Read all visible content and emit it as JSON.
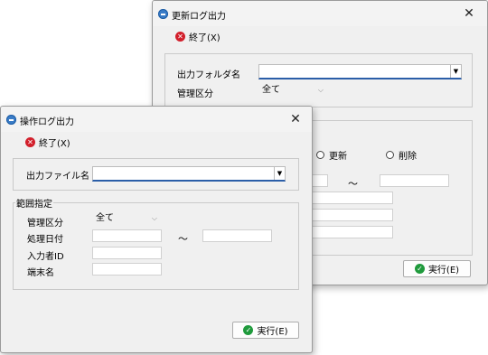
{
  "back_window": {
    "title": "更新ログ出力",
    "exit_label": "終了(X)",
    "folder_label": "出力フォルダ名",
    "folder_value": "",
    "category_label": "管理区分",
    "category_value": "全て",
    "radio_update": "更新",
    "radio_delete": "削除",
    "tilde": "～",
    "execute_label": "実行(E)"
  },
  "front_window": {
    "title": "操作ログ出力",
    "exit_label": "終了(X)",
    "file_label": "出力ファイル名",
    "file_value": "",
    "range_group_title": "範囲指定",
    "category_label": "管理区分",
    "category_value": "全て",
    "date_label": "処理日付",
    "date_from": "",
    "date_to": "",
    "tilde": "～",
    "user_id_label": "入力者ID",
    "user_id_value": "",
    "terminal_label": "端末名",
    "terminal_value": "",
    "execute_label": "実行(E)"
  },
  "icons": {
    "app": "app-icon",
    "close": "close-icon",
    "exit": "x-circle-icon",
    "execute": "check-circle-icon",
    "dropdown": "chevron-down-icon"
  },
  "colors": {
    "accent": "#2b5ea8",
    "exit_red": "#d21f2b",
    "execute_green": "#1f9a3c"
  }
}
